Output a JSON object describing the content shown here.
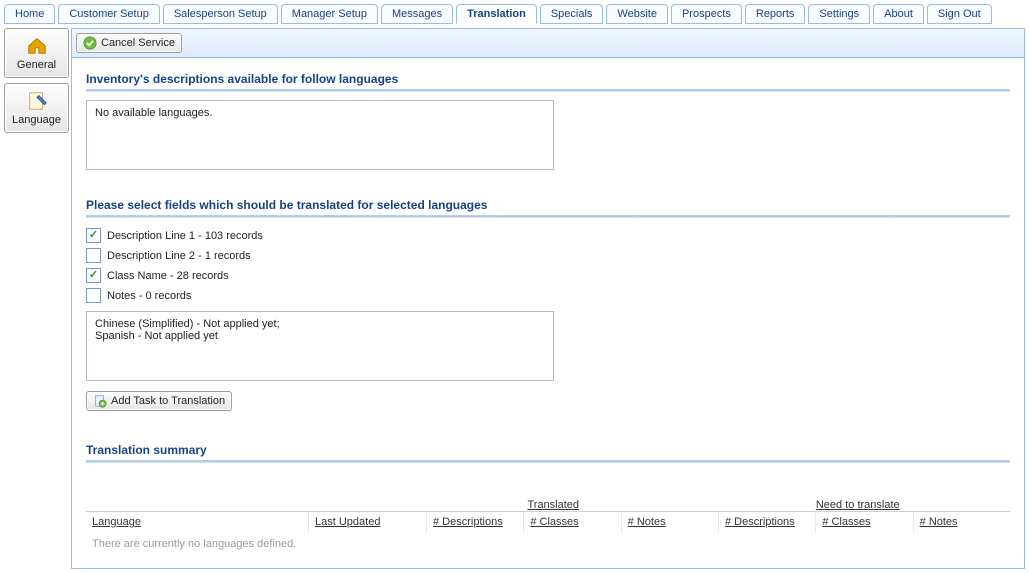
{
  "tabs": [
    "Home",
    "Customer Setup",
    "Salesperson Setup",
    "Manager Setup",
    "Messages",
    "Translation",
    "Specials",
    "Website",
    "Prospects",
    "Reports",
    "Settings",
    "About",
    "Sign Out"
  ],
  "active_tab": "Translation",
  "sidebar": {
    "general": "General",
    "language": "Language"
  },
  "toolbar": {
    "cancel_service": "Cancel Service"
  },
  "section1": {
    "title": "Inventory's descriptions available for follow languages",
    "box": "No available languages."
  },
  "section2": {
    "title": "Please select fields which should be translated for selected languages",
    "options": [
      {
        "label": "Description Line 1 - 103 records",
        "checked": true
      },
      {
        "label": "Description Line 2 - 1 records",
        "checked": false
      },
      {
        "label": "Class Name - 28 records",
        "checked": true
      },
      {
        "label": "Notes - 0 records",
        "checked": false
      }
    ],
    "status_box": "Chinese (Simplified) - Not applied yet;\nSpanish - Not applied yet",
    "add_button": "Add Task to Translation"
  },
  "section3": {
    "title": "Translation summary",
    "group_translated": "Translated",
    "group_need": "Need to translate",
    "cols": {
      "language": "Language",
      "last_updated": "Last Updated",
      "descriptions": "# Descriptions",
      "classes": "# Classes",
      "notes": "# Notes"
    },
    "empty": "There are currently no languages defined."
  }
}
